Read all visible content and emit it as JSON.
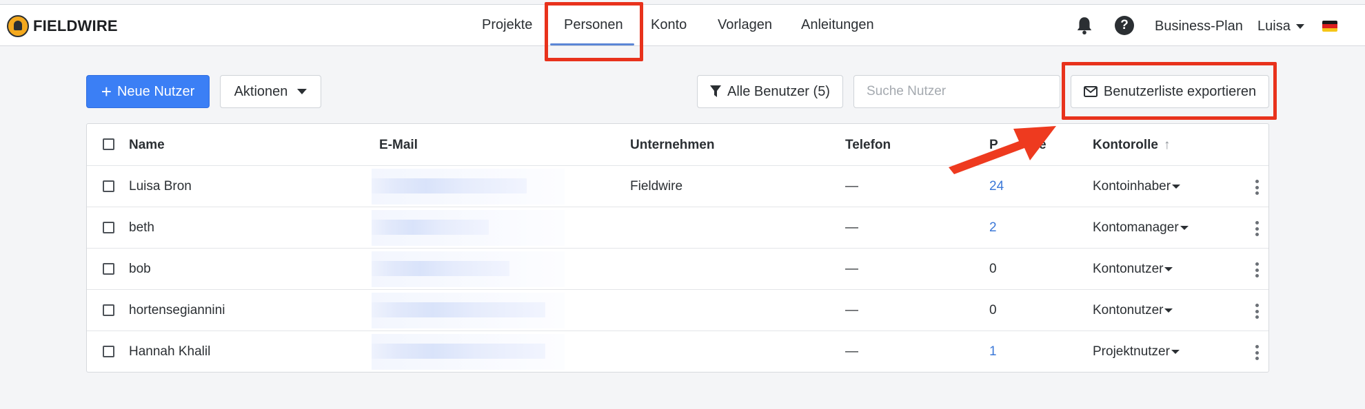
{
  "brand": {
    "name": "FIELDWIRE"
  },
  "nav": {
    "items": [
      {
        "label": "Projekte",
        "active": false
      },
      {
        "label": "Personen",
        "active": true
      },
      {
        "label": "Konto",
        "active": false
      },
      {
        "label": "Vorlagen",
        "active": false
      },
      {
        "label": "Anleitungen",
        "active": false
      }
    ]
  },
  "header_right": {
    "bell_icon": "bell-icon",
    "help_label": "?",
    "plan_label": "Business-Plan",
    "user_label": "Luisa",
    "flag": [
      "#1a1a1a",
      "#dd1f1f",
      "#f5c518"
    ]
  },
  "toolbar": {
    "new_user_label": "Neue Nutzer",
    "actions_label": "Aktionen",
    "filter_label": "Alle Benutzer (5)",
    "search_placeholder": "Suche Nutzer",
    "export_label": "Benutzerliste exportieren"
  },
  "table": {
    "columns": {
      "name": "Name",
      "email": "E-Mail",
      "company": "Unternehmen",
      "phone": "Telefon",
      "projects": "P",
      "projects_tail": "e",
      "role": "Kontorolle",
      "role_sort_icon": "↑"
    },
    "rows": [
      {
        "name": "Luisa Bron",
        "company": "Fieldwire",
        "phone": "—",
        "projects": "24",
        "projects_link": true,
        "role": "Kontoinhaber"
      },
      {
        "name": "beth",
        "company": "",
        "phone": "—",
        "projects": "2",
        "projects_link": true,
        "role": "Kontomanager"
      },
      {
        "name": "bob",
        "company": "",
        "phone": "—",
        "projects": "0",
        "projects_link": false,
        "role": "Kontonutzer"
      },
      {
        "name": "hortensegiannini",
        "company": "",
        "phone": "—",
        "projects": "0",
        "projects_link": false,
        "role": "Kontonutzer"
      },
      {
        "name": "Hannah Khalil",
        "company": "",
        "phone": "—",
        "projects": "1",
        "projects_link": true,
        "role": "Projektnutzer"
      }
    ]
  },
  "colors": {
    "accent": "#3b7ff5",
    "link": "#3b78d8",
    "highlight": "#e8321c"
  }
}
